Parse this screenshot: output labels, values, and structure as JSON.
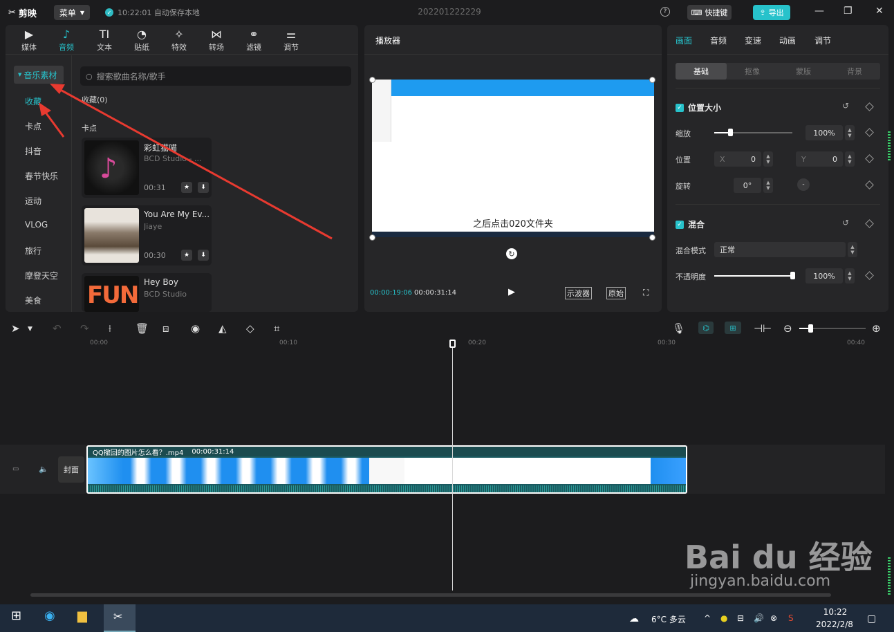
{
  "app": {
    "logo": "剪映",
    "menu": "菜单",
    "autosave": "10:22:01 自动保存本地",
    "project_name": "202201222229",
    "shortcut": "快捷键",
    "export": "导出"
  },
  "left": {
    "tabs": [
      {
        "icon": "media-icon",
        "label": "媒体"
      },
      {
        "icon": "audio-icon",
        "label": "音频"
      },
      {
        "icon": "text-icon",
        "label": "文本"
      },
      {
        "icon": "sticker-icon",
        "label": "贴纸"
      },
      {
        "icon": "effects-icon",
        "label": "特效"
      },
      {
        "icon": "transition-icon",
        "label": "转场"
      },
      {
        "icon": "filter-icon",
        "label": "滤镜"
      },
      {
        "icon": "adjust-icon",
        "label": "调节"
      }
    ],
    "active_tab": "音频",
    "sidebar": [
      "音乐素材",
      "收藏",
      "卡点",
      "抖音",
      "春节快乐",
      "运动",
      "VLOG",
      "旅行",
      "摩登天空",
      "美食"
    ],
    "search_placeholder": "搜索歌曲名称/歌手",
    "favorites_label": "收藏(0)",
    "section_label": "卡点",
    "songs": [
      {
        "title": "彩虹猫喵",
        "artist": "BCD Studio - ...",
        "duration": "00:31"
      },
      {
        "title": "You Are My Ev...",
        "artist": "Jiaye",
        "duration": "00:30"
      },
      {
        "title": "Hey Boy",
        "artist": "BCD Studio",
        "duration": ""
      }
    ],
    "fun_text": "FUN"
  },
  "player": {
    "title": "播放器",
    "subtitle": "之后点击020文件夹",
    "current": "00:00:19:06",
    "total": "00:00:31:14",
    "scope": "示波器",
    "ratio": "原始"
  },
  "right": {
    "tabs": [
      "画面",
      "音频",
      "变速",
      "动画",
      "调节"
    ],
    "segments": [
      "基础",
      "抠像",
      "蒙版",
      "背景"
    ],
    "pos_section": "位置大小",
    "scale_label": "缩放",
    "scale_value": "100%",
    "scale_level": 0.2,
    "position_label": "位置",
    "x_label": "X",
    "x_value": "0",
    "y_label": "Y",
    "y_value": "0",
    "rotate_label": "旋转",
    "rotate_value": "0°",
    "blend_section": "混合",
    "blend_mode_label": "混合模式",
    "blend_mode_value": "正常",
    "opacity_label": "不透明度",
    "opacity_value": "100%",
    "opacity_level": 1.0
  },
  "timeline": {
    "ticks": [
      "00:00",
      "00:10",
      "00:20",
      "00:30",
      "00:40"
    ],
    "clip_name": "QQ撤回的图片怎么看？.mp4",
    "clip_duration": "00:00:31:14",
    "cover": "封面"
  },
  "taskbar": {
    "weather": "6°C 多云",
    "time": "10:22",
    "date": "2022/2/8"
  },
  "watermark": {
    "brand": "Bai du 经验",
    "url": "jingyan.baidu.com"
  },
  "colors": {
    "accent": "#27c2cb",
    "bg": "#1c1c1e",
    "panel": "#262628",
    "arrow": "#e83a30"
  }
}
